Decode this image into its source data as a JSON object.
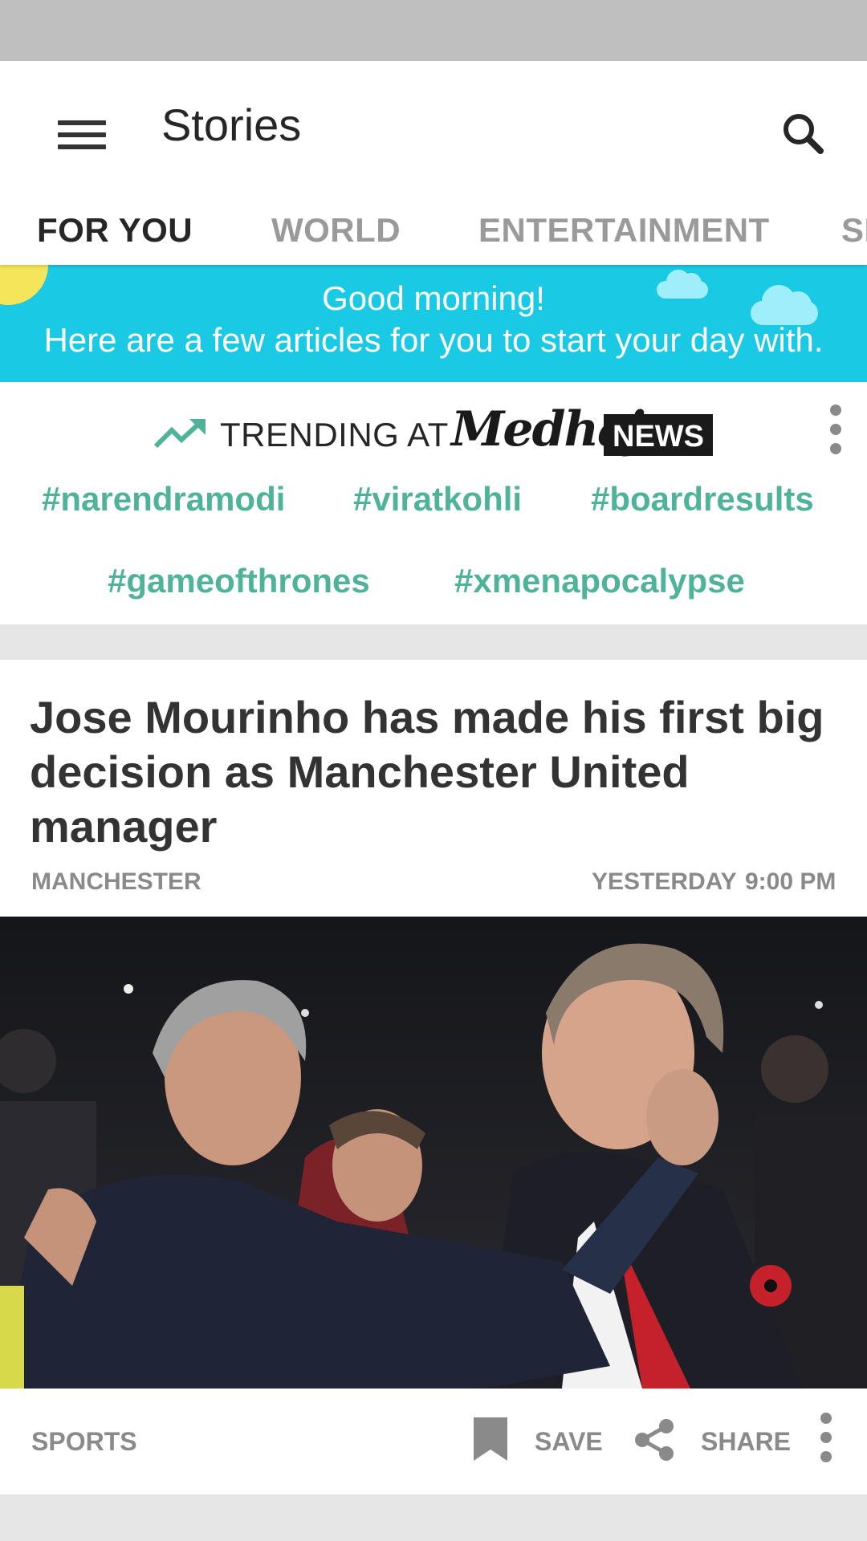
{
  "app_bar": {
    "title": "Stories",
    "menu_icon": "menu-icon",
    "search_icon": "search-icon"
  },
  "tabs": [
    {
      "label": "FOR YOU",
      "active": true
    },
    {
      "label": "WORLD",
      "active": false
    },
    {
      "label": "ENTERTAINMENT",
      "active": false
    },
    {
      "label": "SP",
      "active": false
    }
  ],
  "greeting": {
    "line1": "Good morning!",
    "line2": "Here are a few articles for you to start your day with."
  },
  "trending": {
    "prefix": "TRENDING AT",
    "brand_script": "Medhaj",
    "brand_box": "NEWS",
    "icon": "trending-up-icon",
    "tags": [
      "#narendramodi",
      "#viratkohli",
      "#boardresults",
      "#gameofthrones",
      "#xmenapocalypse"
    ]
  },
  "article": {
    "headline": "Jose Mourinho has made his first big decision as Manchester United manager",
    "location": "MANCHESTER",
    "time_day": "YESTERDAY",
    "time": "9:00 PM",
    "image_icon": "news-photo",
    "category": "SPORTS",
    "save_label": "SAVE",
    "share_label": "SHARE",
    "save_icon": "bookmark-icon",
    "share_icon": "share-icon"
  },
  "colors": {
    "greeting_bg": "#1ac9e4",
    "tag_color": "#4fb39a",
    "status_bar": "#bfbfbf"
  }
}
